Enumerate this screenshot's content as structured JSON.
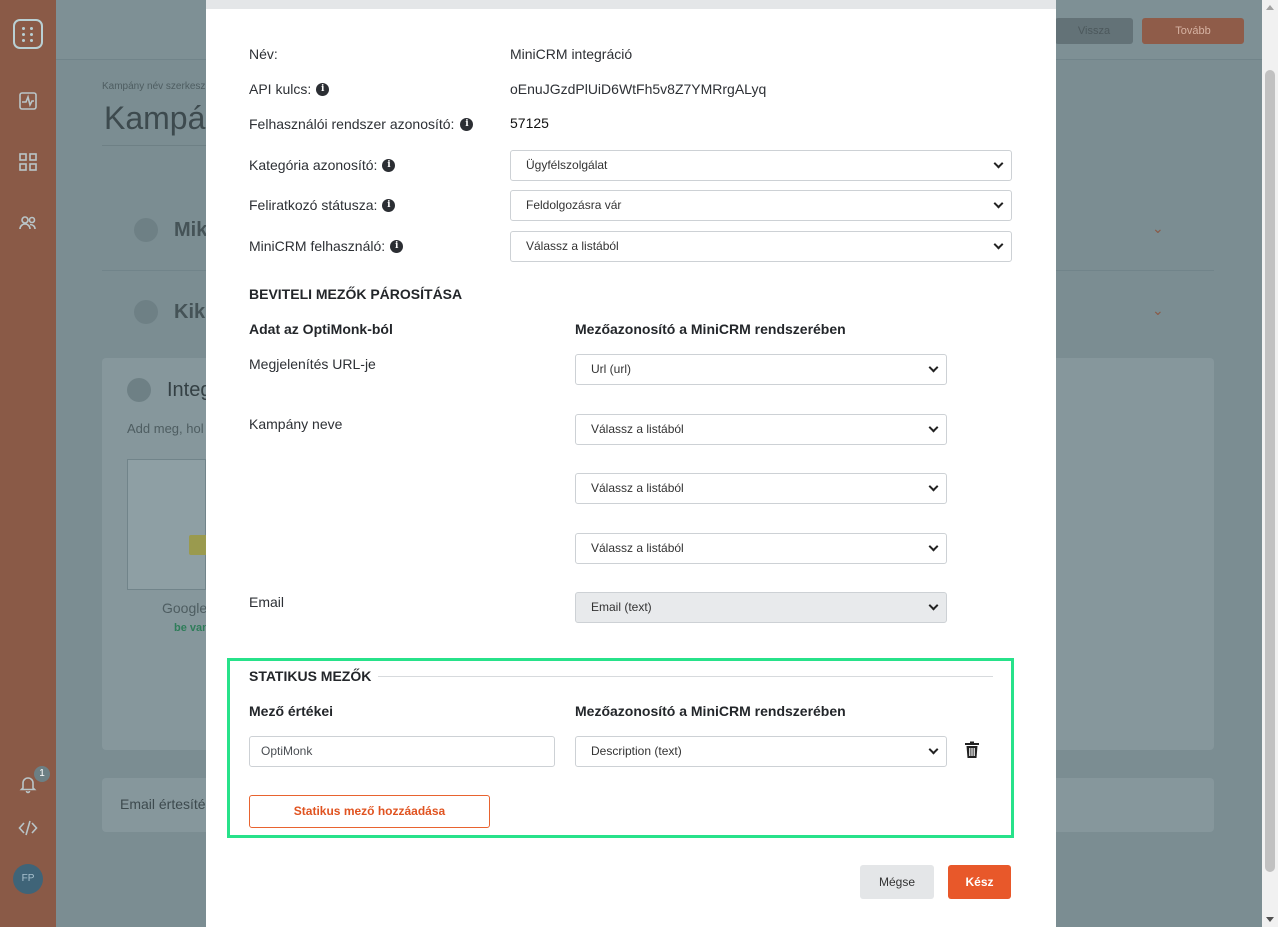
{
  "background": {
    "top_buttons": {
      "back": "Vissza",
      "next": "Tovább"
    },
    "breadcrumb": "Kampány név szerkesz",
    "page_title": "Kampán",
    "sections": [
      {
        "label": "Mik"
      },
      {
        "label": "Kik"
      },
      {
        "label": "Integ"
      }
    ],
    "integration_hint": "Add meg, hol",
    "google_label": "Google",
    "google_status": "be van",
    "email_notify": "Email értesíté",
    "notification_count": "1",
    "avatar_initials": "FP"
  },
  "modal": {
    "fields": {
      "name_label": "Név:",
      "name_value": "MiniCRM integráció",
      "api_key_label": "API kulcs:",
      "api_key_value": "oEnuJGzdPlUiD6WtFh5v8Z7YMRrgALyq",
      "system_id_label": "Felhasználói rendszer azonosító:",
      "system_id_value": "57125",
      "category_label": "Kategória azonosító:",
      "category_value": "Ügyfélszolgálat",
      "subscriber_status_label": "Feliratkozó státusza:",
      "subscriber_status_value": "Feldolgozásra vár",
      "minicrm_user_label": "MiniCRM felhasználó:",
      "minicrm_user_value": "Válassz a listából"
    },
    "input_mapping": {
      "title": "BEVITELI MEZŐK PÁROSÍTÁSA",
      "col_left": "Adat az OptiMonk-ból",
      "col_right": "Mezőazonosító a MiniCRM rendszerében",
      "rows": [
        {
          "label": "Megjelenítés URL-je",
          "value": "Url (url)"
        },
        {
          "label": "Kampány neve",
          "value": "Válassz a listából"
        },
        {
          "label": "",
          "value": "Válassz a listából"
        },
        {
          "label": "",
          "value": "Válassz a listából"
        },
        {
          "label": "Email",
          "value": "Email (text)"
        }
      ]
    },
    "static_fields": {
      "title": "STATIKUS MEZŐK",
      "col_left": "Mező értékei",
      "col_right": "Mezőazonosító a MiniCRM rendszerében",
      "row_value": "OptiMonk",
      "row_field": "Description (text)",
      "add_button": "Statikus mező hozzáadása"
    },
    "footer": {
      "cancel": "Mégse",
      "done": "Kész"
    }
  },
  "colors": {
    "accent": "#e8582a",
    "highlight": "#27e28a",
    "sidebar": "#8a5a47"
  }
}
